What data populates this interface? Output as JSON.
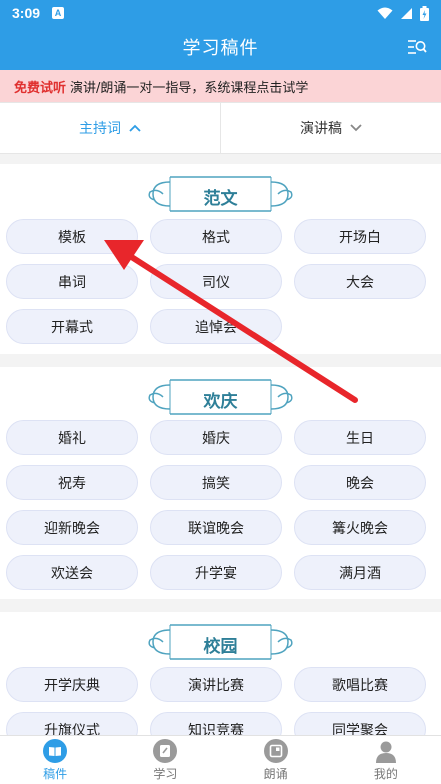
{
  "status_bar": {
    "time": "3:09",
    "notif": "A"
  },
  "header": {
    "title": "学习稿件"
  },
  "banner": {
    "highlight": "免费试听",
    "text": "演讲/朗诵一对一指导，系统课程点击试学"
  },
  "filters": {
    "left": "主持词",
    "right": "演讲稿"
  },
  "sections": [
    {
      "title": "范文",
      "items": [
        "模板",
        "格式",
        "开场白",
        "串词",
        "司仪",
        "大会",
        "开幕式",
        "追悼会"
      ]
    },
    {
      "title": "欢庆",
      "items": [
        "婚礼",
        "婚庆",
        "生日",
        "祝寿",
        "搞笑",
        "晚会",
        "迎新晚会",
        "联谊晚会",
        "篝火晚会",
        "欢送会",
        "升学宴",
        "满月酒"
      ]
    },
    {
      "title": "校园",
      "items": [
        "开学庆典",
        "演讲比赛",
        "歌唱比赛",
        "升旗仪式",
        "知识竞赛",
        "同学聚会"
      ]
    }
  ],
  "tabs": [
    {
      "label": "稿件",
      "icon": "book-icon",
      "active": true
    },
    {
      "label": "学习",
      "icon": "study-icon",
      "active": false
    },
    {
      "label": "朗诵",
      "icon": "recite-icon",
      "active": false
    },
    {
      "label": "我的",
      "icon": "user-icon",
      "active": false
    }
  ],
  "colors": {
    "primary": "#2e9de6",
    "banner_bg": "#fbd4d6",
    "highlight": "#e0302f",
    "section_title": "#2e7f98",
    "arrow": "#e8262b"
  }
}
